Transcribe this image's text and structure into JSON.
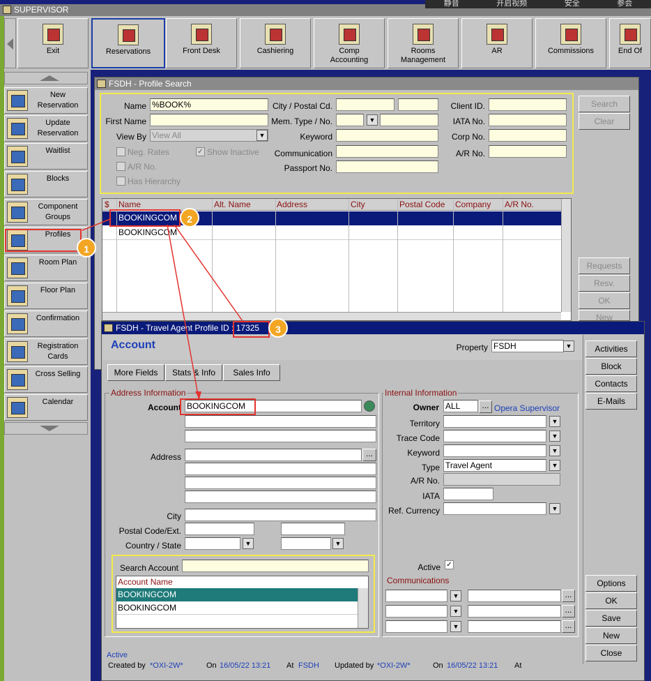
{
  "app": {
    "title": "SUPERVISOR",
    "sys_tabs": [
      "静音",
      "开启视频",
      "安全",
      "参会"
    ]
  },
  "toolbar": [
    {
      "label": "Exit",
      "icon": "exit-icon"
    },
    {
      "label": "Reservations",
      "icon": "reservations-icon"
    },
    {
      "label": "Front Desk",
      "icon": "front-desk-icon"
    },
    {
      "label": "Cashiering",
      "icon": "cashiering-icon"
    },
    {
      "label": "Comp\nAccounting",
      "icon": "comp-accounting-icon"
    },
    {
      "label": "Rooms\nManagement",
      "icon": "rooms-management-icon"
    },
    {
      "label": "AR",
      "icon": "ar-icon"
    },
    {
      "label": "Commissions",
      "icon": "commissions-icon"
    },
    {
      "label": "End Of",
      "icon": "end-of-day-icon"
    }
  ],
  "sidebar": [
    {
      "label": "New\nReservation"
    },
    {
      "label": "Update\nReservation"
    },
    {
      "label": "Waitlist"
    },
    {
      "label": "Blocks"
    },
    {
      "label": "Component\nGroups"
    },
    {
      "label": "Profiles"
    },
    {
      "label": "Room Plan"
    },
    {
      "label": "Floor Plan"
    },
    {
      "label": "Confirmation"
    },
    {
      "label": "Registration\nCards"
    },
    {
      "label": "Cross Selling"
    },
    {
      "label": "Calendar"
    }
  ],
  "search": {
    "title": "FSDH - Profile Search",
    "name_label": "Name",
    "name_value": "%BOOK%",
    "first_name_label": "First Name",
    "view_by_label": "View By",
    "view_by_value": "View All",
    "neg_rates": "Neg. Rates",
    "show_inactive": "Show Inactive",
    "ar_no": "A/R No.",
    "has_hierarchy": "Has Hierarchy",
    "city_label": "City / Postal Cd.",
    "mem_label": "Mem. Type / No.",
    "keyword_label": "Keyword",
    "communication_label": "Communication",
    "passport_label": "Passport No.",
    "client_label": "Client ID.",
    "iata_label": "IATA No.",
    "corp_label": "Corp No.",
    "ar_label": "A/R No.",
    "search_btn": "Search",
    "clear_btn": "Clear",
    "requests_btn": "Requests",
    "resv_btn": "Resv.",
    "ok_btn": "OK",
    "new_btn": "New",
    "columns": [
      "$",
      "Name",
      "Alt. Name",
      "Address",
      "City",
      "Postal Code",
      "Company",
      "A/R No."
    ],
    "rows": [
      "BOOKINGCOM",
      "BOOKINGCOM"
    ]
  },
  "profile": {
    "title": "FSDH - Travel Agent Profile ID : 17325",
    "heading": "Account",
    "property_label": "Property",
    "property_value": "FSDH",
    "tabs": [
      "More Fields",
      "Stats & Info",
      "Sales Info"
    ],
    "address_group": "Address Information",
    "account_label": "Account",
    "account_value": "BOOKINGCOM",
    "address_label": "Address",
    "city_label": "City",
    "postal_label": "Postal Code/Ext.",
    "country_label": "Country / State",
    "search_account_label": "Search Account",
    "account_name_header": "Account Name",
    "account_names": [
      "BOOKINGCOM",
      "BOOKINGCOM"
    ],
    "internal_group": "Internal Information",
    "owner_label": "Owner",
    "owner_value": "ALL",
    "owner_name": "Opera Supervisor",
    "territory_label": "Territory",
    "trace_label": "Trace Code",
    "keyword_label": "Keyword",
    "type_label": "Type",
    "type_value": "Travel Agent",
    "ar_label": "A/R No.",
    "iata_label": "IATA",
    "currency_label": "Ref. Currency",
    "active_label": "Active",
    "communications_label": "Communications",
    "right_buttons": [
      "Activities",
      "Block",
      "Contacts",
      "E-Mails"
    ],
    "bottom_buttons": [
      "Options",
      "OK",
      "Save",
      "New",
      "Close"
    ],
    "status": "Active",
    "footer": {
      "created_by_label": "Created by",
      "created_by": "*OXI-2W*",
      "on_label": "On",
      "created_on": "16/05/22 13:21",
      "at_label": "At",
      "created_at": "FSDH",
      "updated_by_label": "Updated by",
      "updated_by": "*OXI-2W*",
      "updated_on": "16/05/22 13:21"
    }
  },
  "annotations": [
    "1",
    "2",
    "3"
  ]
}
